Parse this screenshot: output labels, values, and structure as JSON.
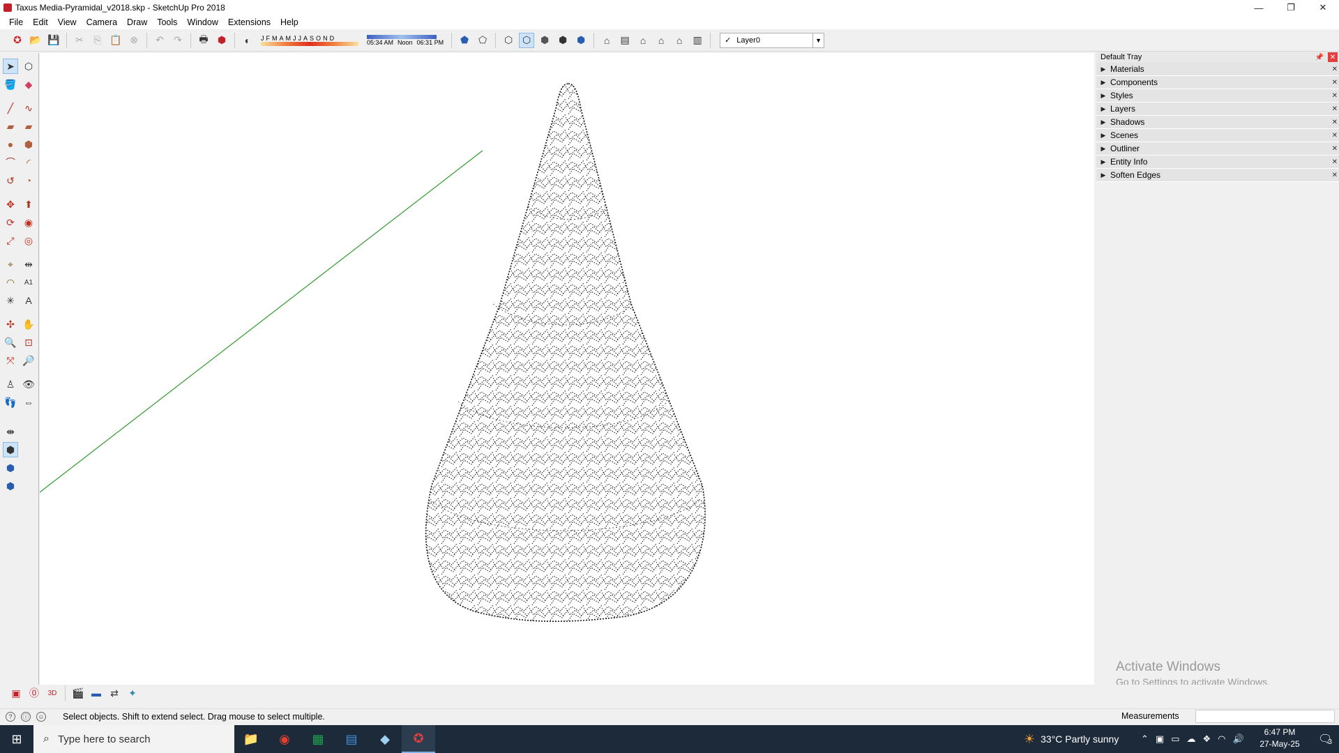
{
  "window": {
    "title": "Taxus Media-Pyramidal_v2018.skp - SketchUp Pro 2018",
    "minimize": "—",
    "maximize": "❐",
    "close": "✕"
  },
  "menu": [
    "File",
    "Edit",
    "View",
    "Camera",
    "Draw",
    "Tools",
    "Window",
    "Extensions",
    "Help"
  ],
  "shadow": {
    "months": [
      "J",
      "F",
      "M",
      "A",
      "M",
      "J",
      "J",
      "A",
      "S",
      "O",
      "N",
      "D"
    ],
    "time_start": "05:34 AM",
    "time_mid": "Noon",
    "time_end": "06:31 PM"
  },
  "layer": {
    "check": "✓",
    "name": "Layer0",
    "dropdown": "▼"
  },
  "tray": {
    "title": "Default Tray",
    "panels": [
      "Materials",
      "Components",
      "Styles",
      "Layers",
      "Shadows",
      "Scenes",
      "Outliner",
      "Entity Info",
      "Soften Edges"
    ]
  },
  "watermark": {
    "line1": "Activate Windows",
    "line2": "Go to Settings to activate Windows."
  },
  "status": {
    "text": "Select objects. Shift to extend select. Drag mouse to select multiple.",
    "measurements_label": "Measurements"
  },
  "taskbar": {
    "search_placeholder": "Type here to search",
    "weather": "33°C  Partly sunny",
    "time": "6:47 PM",
    "date": "27-May-25",
    "notifications": "3"
  },
  "colors": {
    "green_axis": "#2e9a2e",
    "taskbar_bg": "#1c2a3a"
  }
}
